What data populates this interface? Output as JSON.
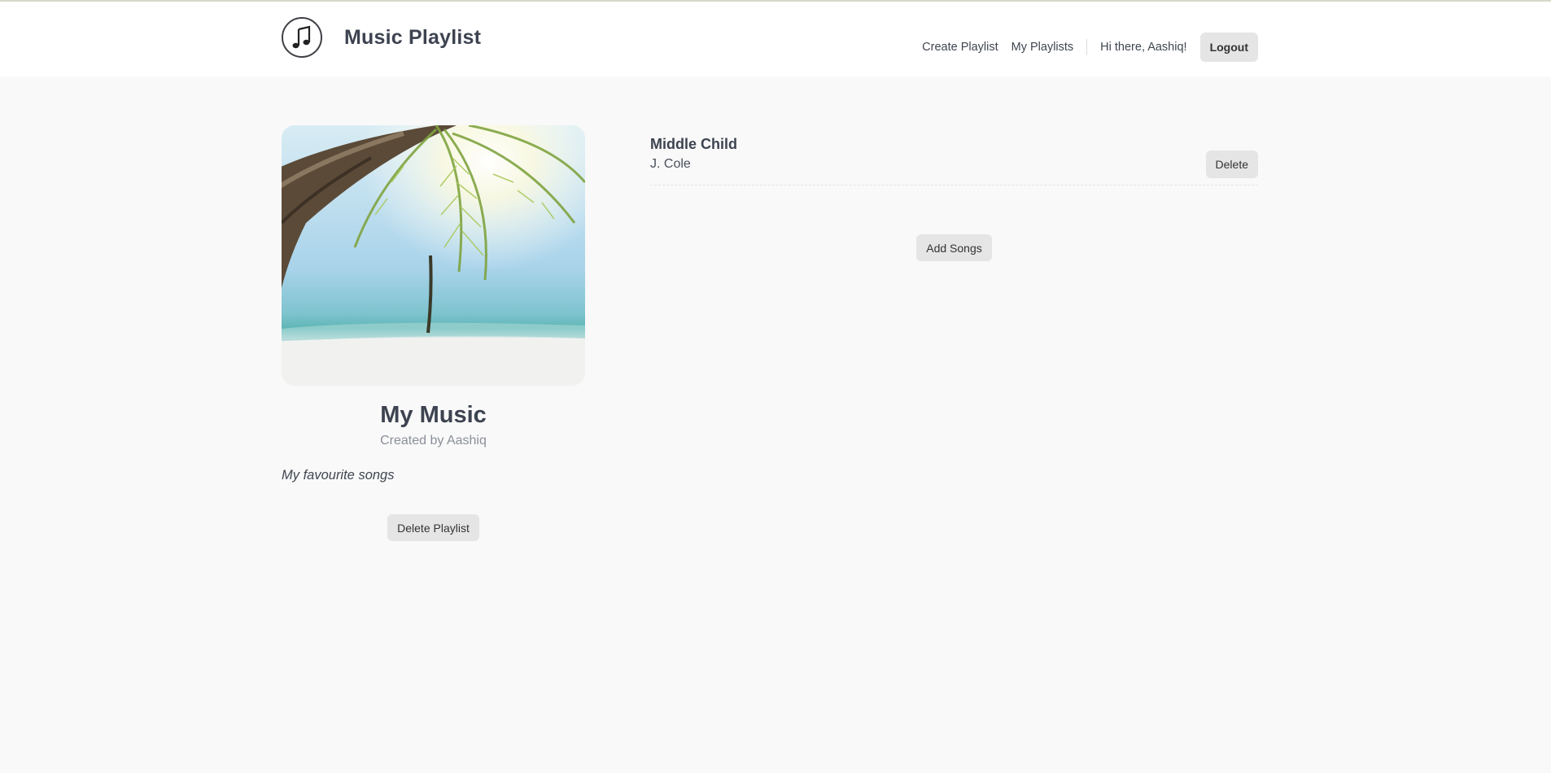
{
  "app": {
    "title": "Music Playlist",
    "logo_icon": "music-note-icon"
  },
  "nav": {
    "create_playlist": "Create Playlist",
    "my_playlists": "My Playlists",
    "greeting": "Hi there, Aashiq!",
    "logout": "Logout"
  },
  "playlist": {
    "cover_image": "palm-beach-image",
    "title": "My Music",
    "created_by": "Created by Aashiq",
    "description": "My favourite songs",
    "delete_label": "Delete Playlist"
  },
  "songs": [
    {
      "title": "Middle Child",
      "artist": "J. Cole",
      "delete_label": "Delete"
    }
  ],
  "add_songs_label": "Add Songs",
  "colors": {
    "background": "#f9f9f9",
    "header": "#ffffff",
    "button": "#e5e5e5",
    "text": "#404650"
  }
}
